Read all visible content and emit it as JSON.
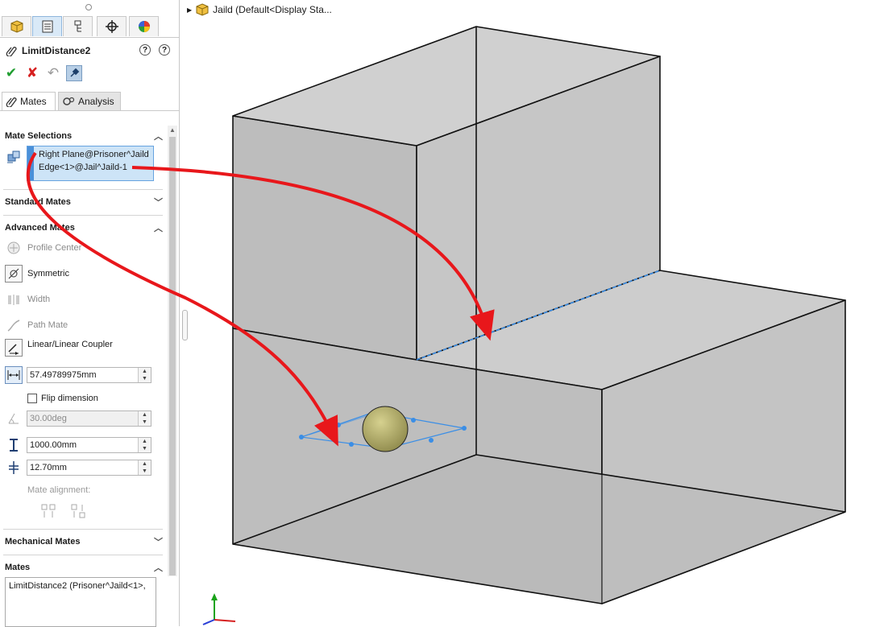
{
  "feature": {
    "name": "LimitDistance2"
  },
  "toolbar": {
    "icons": [
      "ok-icon",
      "cancel-icon",
      "undo-icon",
      "pin-icon"
    ]
  },
  "tabs": [
    {
      "name": "feature-manager-tab"
    },
    {
      "name": "property-manager-tab",
      "active": true
    },
    {
      "name": "configuration-manager-tab"
    },
    {
      "name": "dimxpert-tab"
    },
    {
      "name": "display-manager-tab"
    }
  ],
  "subtabs": {
    "mates": "Mates",
    "analysis": "Analysis"
  },
  "sections": {
    "mate_selections": "Mate Selections",
    "standard_mates": "Standard Mates",
    "advanced_mates": "Advanced Mates",
    "mechanical_mates": "Mechanical Mates",
    "mates": "Mates"
  },
  "selections": [
    "Right Plane@Prisoner^Jaild",
    "Edge<1>@Jail^Jaild-1"
  ],
  "advanced": {
    "profile_center": "Profile Center",
    "symmetric": "Symmetric",
    "width": "Width",
    "path_mate": "Path Mate",
    "linear_coupler": "Linear/Linear Coupler"
  },
  "fields": {
    "distance": "57.49789975mm",
    "flip_label": "Flip dimension",
    "angle": "30.00deg",
    "max": "1000.00mm",
    "min": "12.70mm"
  },
  "mate_alignment_label": "Mate alignment:",
  "mates_list": [
    "LimitDistance2 (Prisoner^Jaild<1>,"
  ],
  "tree": {
    "label": "Jaild  (Default<Display Sta..."
  },
  "colors": {
    "accent": "#4a90d9",
    "arrow": "#e8171b",
    "selection_bg": "#cde4f7",
    "edge_highlight": "#3a8ee6"
  }
}
